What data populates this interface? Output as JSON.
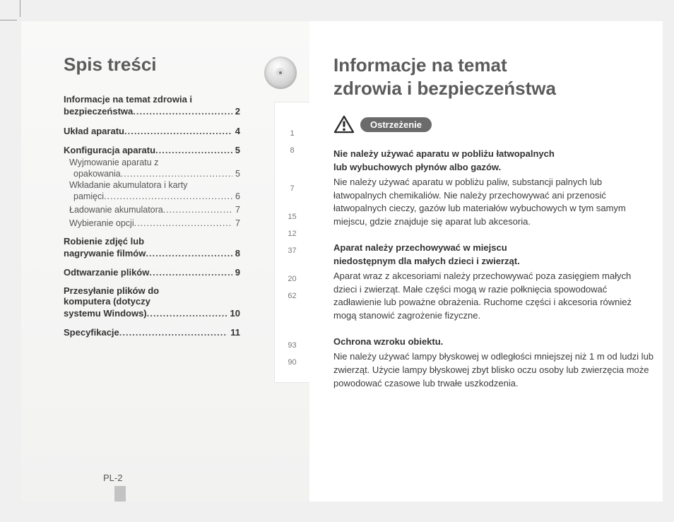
{
  "left": {
    "title": "Spis treści",
    "toc": {
      "item1_line1": "Informacje na temat zdrowia i",
      "item1_line2": "bezpieczeństwa",
      "item1_pg": "2",
      "item2": "Układ aparatu",
      "item2_pg": "4",
      "item3": "Konfiguracja aparatu",
      "item3_pg": "5",
      "item3a_line1": "Wyjmowanie aparatu z",
      "item3a_line2": "opakowania",
      "item3a_pg": "5",
      "item3b_line1": "Wkładanie akumulatora i karty",
      "item3b_line2": "pamięci",
      "item3b_pg": "6",
      "item3c": "Ładowanie akumulatora",
      "item3c_pg": "7",
      "item3d": "Wybieranie opcji",
      "item3d_pg": "7",
      "item4_line1": "Robienie zdjęć lub",
      "item4_line2": "nagrywanie filmów",
      "item4_pg": "8",
      "item5": "Odtwarzanie plików",
      "item5_pg": "9",
      "item6_line1": "Przesyłanie plików do",
      "item6_line2": "komputera (dotyczy",
      "item6_line3": "systemu Windows)",
      "item6_pg": "10",
      "item7": "Specyfikacje",
      "item7_pg": "11"
    },
    "index": {
      "n0": "1",
      "n1": "8",
      "n2": "7",
      "n3": "15",
      "n4": "12",
      "n5": "37",
      "n6": "20",
      "n7": "62",
      "n8": "93",
      "n9": "90"
    },
    "page_number": "PL-2"
  },
  "right": {
    "title_line1": "Informacje na temat",
    "title_line2": "zdrowia i bezpieczeństwa",
    "warning_label": "Ostrzeżenie",
    "sec1": {
      "heading_l1": "Nie należy używać aparatu w pobliżu łatwopalnych",
      "heading_l2": "lub wybuchowych płynów albo gazów.",
      "body": "Nie należy używać aparatu w pobliżu paliw, substancji palnych lub łatwopalnych chemikaliów. Nie należy przechowywać ani przenosić łatwopalnych cieczy, gazów lub materiałów wybuchowych w tym samym miejscu, gdzie znajduje się aparat lub akcesoria."
    },
    "sec2": {
      "heading_l1": "Aparat należy przechowywać w miejscu",
      "heading_l2": "niedostępnym dla małych dzieci i zwierząt.",
      "body": "Aparat wraz z akcesoriami należy przechowywać poza zasięgiem małych dzieci i zwierząt. Małe części mogą w razie połknięcia spowodować zadławienie lub poważne obrażenia. Ruchome części i akcesoria również mogą stanowić zagrożenie fizyczne."
    },
    "sec3": {
      "heading": "Ochrona wzroku obiektu.",
      "body": "Nie należy używać lampy błyskowej w odległości mniejszej niż 1 m od ludzi lub zwierząt. Użycie lampy błyskowej zbyt blisko oczu osoby lub zwierzęcia może powodować czasowe lub trwałe uszkodzenia."
    }
  }
}
